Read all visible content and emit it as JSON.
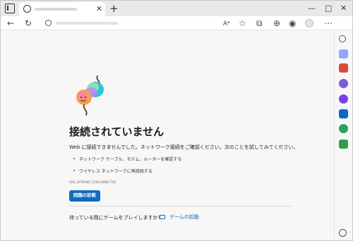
{
  "tab": {
    "new_tab_label": "+",
    "close_label": "✕"
  },
  "window_controls": {
    "minimize": "—",
    "maximize": "□",
    "close": "✕"
  },
  "toolbar": {
    "back": "←",
    "refresh": "↻",
    "read_aloud": "Aᵃ",
    "favorite": "☆",
    "extensions": "⧉",
    "collections": "⊕",
    "copilot": "◉",
    "menu": "⋯"
  },
  "error_page": {
    "title": "接続されていません",
    "description": "Web に接続できませんでした。ネットワーク接続をご確認ください。次のことを試してみてください。",
    "suggestions": [
      "ネットワーク ケーブル、モデム、ルーターを確認する",
      "ワイヤレス ネットワークに再接続する"
    ],
    "error_code": "ERR_INTERNET_DISCONNECTED",
    "diagnose_button": "問題の診断",
    "game_prompt": "待っている間にゲームをプレイしますか?",
    "game_link": "ゲームの起動"
  },
  "colors": {
    "accent": "#0f6cbd"
  },
  "sidebar_icons": [
    "search-icon",
    "tag-icon",
    "toolbox-icon",
    "people-icon",
    "sparkle-icon",
    "outlook-icon",
    "drop-icon",
    "tree-icon",
    "settings-icon"
  ]
}
